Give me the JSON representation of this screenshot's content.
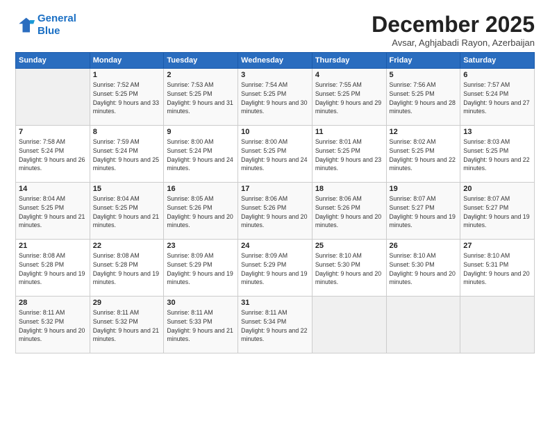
{
  "logo": {
    "line1": "General",
    "line2": "Blue"
  },
  "title": "December 2025",
  "subtitle": "Avsar, Aghjabadi Rayon, Azerbaijan",
  "days_header": [
    "Sunday",
    "Monday",
    "Tuesday",
    "Wednesday",
    "Thursday",
    "Friday",
    "Saturday"
  ],
  "weeks": [
    [
      {
        "num": "",
        "sunrise": "",
        "sunset": "",
        "daylight": ""
      },
      {
        "num": "1",
        "sunrise": "Sunrise: 7:52 AM",
        "sunset": "Sunset: 5:25 PM",
        "daylight": "Daylight: 9 hours and 33 minutes."
      },
      {
        "num": "2",
        "sunrise": "Sunrise: 7:53 AM",
        "sunset": "Sunset: 5:25 PM",
        "daylight": "Daylight: 9 hours and 31 minutes."
      },
      {
        "num": "3",
        "sunrise": "Sunrise: 7:54 AM",
        "sunset": "Sunset: 5:25 PM",
        "daylight": "Daylight: 9 hours and 30 minutes."
      },
      {
        "num": "4",
        "sunrise": "Sunrise: 7:55 AM",
        "sunset": "Sunset: 5:25 PM",
        "daylight": "Daylight: 9 hours and 29 minutes."
      },
      {
        "num": "5",
        "sunrise": "Sunrise: 7:56 AM",
        "sunset": "Sunset: 5:25 PM",
        "daylight": "Daylight: 9 hours and 28 minutes."
      },
      {
        "num": "6",
        "sunrise": "Sunrise: 7:57 AM",
        "sunset": "Sunset: 5:24 PM",
        "daylight": "Daylight: 9 hours and 27 minutes."
      }
    ],
    [
      {
        "num": "7",
        "sunrise": "Sunrise: 7:58 AM",
        "sunset": "Sunset: 5:24 PM",
        "daylight": "Daylight: 9 hours and 26 minutes."
      },
      {
        "num": "8",
        "sunrise": "Sunrise: 7:59 AM",
        "sunset": "Sunset: 5:24 PM",
        "daylight": "Daylight: 9 hours and 25 minutes."
      },
      {
        "num": "9",
        "sunrise": "Sunrise: 8:00 AM",
        "sunset": "Sunset: 5:24 PM",
        "daylight": "Daylight: 9 hours and 24 minutes."
      },
      {
        "num": "10",
        "sunrise": "Sunrise: 8:00 AM",
        "sunset": "Sunset: 5:25 PM",
        "daylight": "Daylight: 9 hours and 24 minutes."
      },
      {
        "num": "11",
        "sunrise": "Sunrise: 8:01 AM",
        "sunset": "Sunset: 5:25 PM",
        "daylight": "Daylight: 9 hours and 23 minutes."
      },
      {
        "num": "12",
        "sunrise": "Sunrise: 8:02 AM",
        "sunset": "Sunset: 5:25 PM",
        "daylight": "Daylight: 9 hours and 22 minutes."
      },
      {
        "num": "13",
        "sunrise": "Sunrise: 8:03 AM",
        "sunset": "Sunset: 5:25 PM",
        "daylight": "Daylight: 9 hours and 22 minutes."
      }
    ],
    [
      {
        "num": "14",
        "sunrise": "Sunrise: 8:04 AM",
        "sunset": "Sunset: 5:25 PM",
        "daylight": "Daylight: 9 hours and 21 minutes."
      },
      {
        "num": "15",
        "sunrise": "Sunrise: 8:04 AM",
        "sunset": "Sunset: 5:25 PM",
        "daylight": "Daylight: 9 hours and 21 minutes."
      },
      {
        "num": "16",
        "sunrise": "Sunrise: 8:05 AM",
        "sunset": "Sunset: 5:26 PM",
        "daylight": "Daylight: 9 hours and 20 minutes."
      },
      {
        "num": "17",
        "sunrise": "Sunrise: 8:06 AM",
        "sunset": "Sunset: 5:26 PM",
        "daylight": "Daylight: 9 hours and 20 minutes."
      },
      {
        "num": "18",
        "sunrise": "Sunrise: 8:06 AM",
        "sunset": "Sunset: 5:26 PM",
        "daylight": "Daylight: 9 hours and 20 minutes."
      },
      {
        "num": "19",
        "sunrise": "Sunrise: 8:07 AM",
        "sunset": "Sunset: 5:27 PM",
        "daylight": "Daylight: 9 hours and 19 minutes."
      },
      {
        "num": "20",
        "sunrise": "Sunrise: 8:07 AM",
        "sunset": "Sunset: 5:27 PM",
        "daylight": "Daylight: 9 hours and 19 minutes."
      }
    ],
    [
      {
        "num": "21",
        "sunrise": "Sunrise: 8:08 AM",
        "sunset": "Sunset: 5:28 PM",
        "daylight": "Daylight: 9 hours and 19 minutes."
      },
      {
        "num": "22",
        "sunrise": "Sunrise: 8:08 AM",
        "sunset": "Sunset: 5:28 PM",
        "daylight": "Daylight: 9 hours and 19 minutes."
      },
      {
        "num": "23",
        "sunrise": "Sunrise: 8:09 AM",
        "sunset": "Sunset: 5:29 PM",
        "daylight": "Daylight: 9 hours and 19 minutes."
      },
      {
        "num": "24",
        "sunrise": "Sunrise: 8:09 AM",
        "sunset": "Sunset: 5:29 PM",
        "daylight": "Daylight: 9 hours and 19 minutes."
      },
      {
        "num": "25",
        "sunrise": "Sunrise: 8:10 AM",
        "sunset": "Sunset: 5:30 PM",
        "daylight": "Daylight: 9 hours and 20 minutes."
      },
      {
        "num": "26",
        "sunrise": "Sunrise: 8:10 AM",
        "sunset": "Sunset: 5:30 PM",
        "daylight": "Daylight: 9 hours and 20 minutes."
      },
      {
        "num": "27",
        "sunrise": "Sunrise: 8:10 AM",
        "sunset": "Sunset: 5:31 PM",
        "daylight": "Daylight: 9 hours and 20 minutes."
      }
    ],
    [
      {
        "num": "28",
        "sunrise": "Sunrise: 8:11 AM",
        "sunset": "Sunset: 5:32 PM",
        "daylight": "Daylight: 9 hours and 20 minutes."
      },
      {
        "num": "29",
        "sunrise": "Sunrise: 8:11 AM",
        "sunset": "Sunset: 5:32 PM",
        "daylight": "Daylight: 9 hours and 21 minutes."
      },
      {
        "num": "30",
        "sunrise": "Sunrise: 8:11 AM",
        "sunset": "Sunset: 5:33 PM",
        "daylight": "Daylight: 9 hours and 21 minutes."
      },
      {
        "num": "31",
        "sunrise": "Sunrise: 8:11 AM",
        "sunset": "Sunset: 5:34 PM",
        "daylight": "Daylight: 9 hours and 22 minutes."
      },
      {
        "num": "",
        "sunrise": "",
        "sunset": "",
        "daylight": ""
      },
      {
        "num": "",
        "sunrise": "",
        "sunset": "",
        "daylight": ""
      },
      {
        "num": "",
        "sunrise": "",
        "sunset": "",
        "daylight": ""
      }
    ]
  ]
}
